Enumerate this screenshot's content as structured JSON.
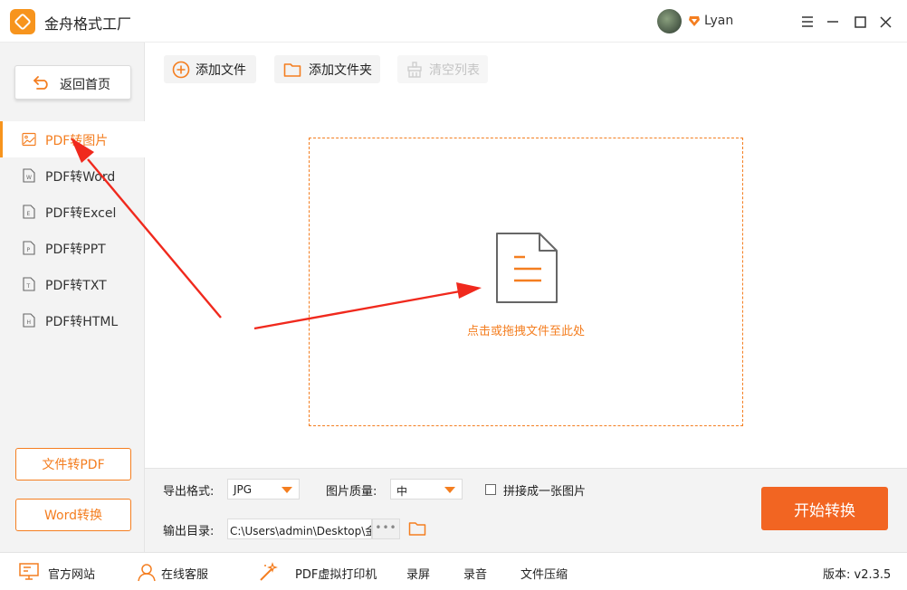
{
  "app": {
    "title": "金舟格式工厂",
    "username": "Lyan"
  },
  "sidebar": {
    "home_label": "返回首页",
    "items": [
      {
        "label": "PDF转图片",
        "icon": "image-icon",
        "active": true
      },
      {
        "label": "PDF转Word",
        "icon": "word-file-icon"
      },
      {
        "label": "PDF转Excel",
        "icon": "excel-file-icon"
      },
      {
        "label": "PDF转PPT",
        "icon": "ppt-file-icon"
      },
      {
        "label": "PDF转TXT",
        "icon": "txt-file-icon"
      },
      {
        "label": "PDF转HTML",
        "icon": "html-file-icon"
      }
    ],
    "bottom_buttons": [
      "文件转PDF",
      "Word转换"
    ]
  },
  "toolbar": {
    "add_file": "添加文件",
    "add_folder": "添加文件夹",
    "clear_list": "清空列表"
  },
  "dropzone": {
    "hint": "点击或拖拽文件至此处"
  },
  "settings": {
    "format_label": "导出格式:",
    "format_value": "JPG",
    "quality_label": "图片质量:",
    "quality_value": "中",
    "merge_label": "拼接成一张图片",
    "output_label": "输出目录:",
    "output_path": "C:\\Users\\admin\\Desktop\\金",
    "more": "•••",
    "start": "开始转换"
  },
  "footer": {
    "website": "官方网站",
    "support": "在线客服",
    "printer": "PDF虚拟打印机",
    "screen_rec": "录屏",
    "audio_rec": "录音",
    "compress": "文件压缩",
    "version": "版本: v2.3.5"
  },
  "colors": {
    "accent": "#f47e20",
    "start_button": "#f26522",
    "arrow": "#f0291d"
  }
}
